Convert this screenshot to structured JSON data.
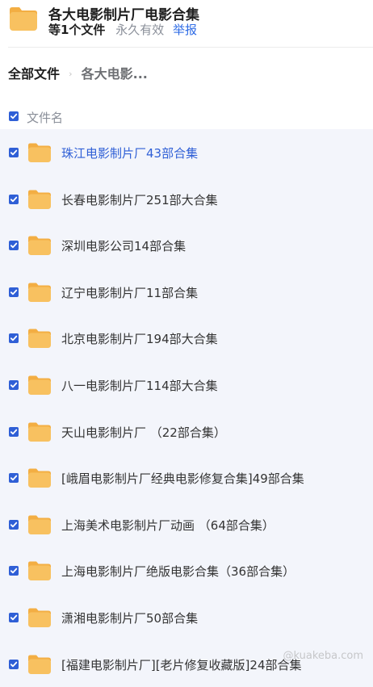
{
  "header": {
    "title": "各大电影制片厂电影合集",
    "count_text": "等1个文件",
    "permanence": "永久有效",
    "report": "举报"
  },
  "breadcrumb": {
    "root": "全部文件",
    "separator": "›",
    "current": "各大电影..."
  },
  "column_header": {
    "label": "文件名"
  },
  "colors": {
    "folder": "#f8c160",
    "folder_tab": "#f3ae43",
    "accent": "#2f5fd6",
    "link": "#2f6ce5",
    "list_bg": "#f3f5fb"
  },
  "files": [
    {
      "name": "珠江电影制片厂43部合集",
      "checked": true,
      "icon": "folder-icon"
    },
    {
      "name": "长春电影制片厂251部大合集",
      "checked": true,
      "icon": "folder-icon"
    },
    {
      "name": "深圳电影公司14部合集",
      "checked": true,
      "icon": "folder-icon"
    },
    {
      "name": "辽宁电影制片厂11部合集",
      "checked": true,
      "icon": "folder-icon"
    },
    {
      "name": "北京电影制片厂194部大合集",
      "checked": true,
      "icon": "folder-icon"
    },
    {
      "name": "八一电影制片厂114部大合集",
      "checked": true,
      "icon": "folder-icon"
    },
    {
      "name": "天山电影制片厂 （22部合集）",
      "checked": true,
      "icon": "folder-icon"
    },
    {
      "name": "[峨眉电影制片厂经典电影修复合集]49部合集",
      "checked": true,
      "icon": "folder-icon"
    },
    {
      "name": "上海美术电影制片厂动画 （64部合集）",
      "checked": true,
      "icon": "folder-icon"
    },
    {
      "name": "上海电影制片厂绝版电影合集（36部合集）",
      "checked": true,
      "icon": "folder-icon"
    },
    {
      "name": "潇湘电影制片厂50部合集",
      "checked": true,
      "icon": "folder-icon"
    },
    {
      "name": "[福建电影制片厂][老片修复收藏版]24部合集",
      "checked": true,
      "icon": "folder-icon"
    }
  ],
  "watermark": "@kuakeba.com"
}
